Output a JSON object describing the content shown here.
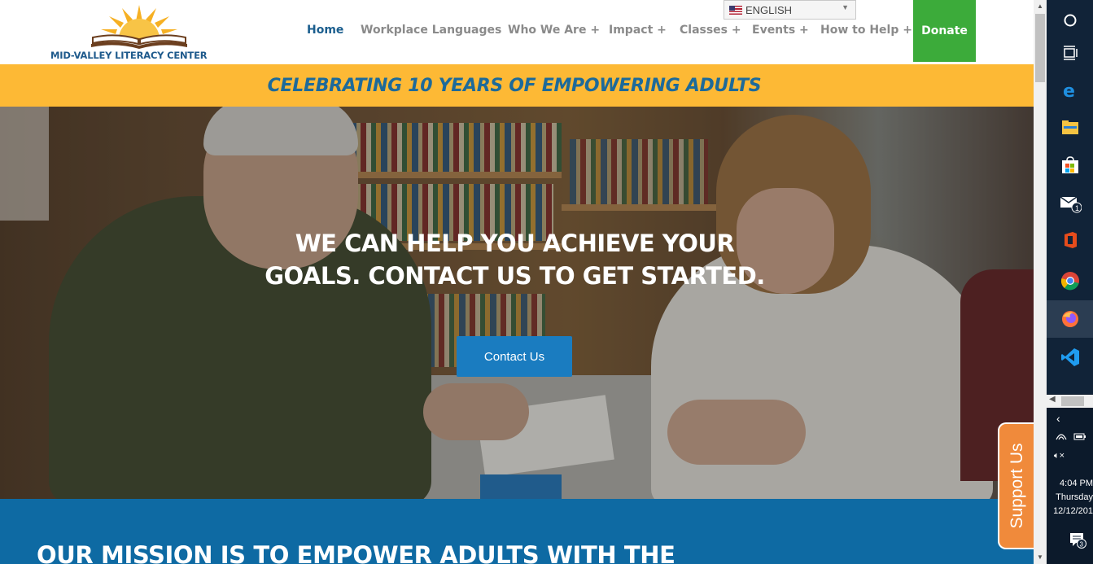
{
  "site": {
    "logo_text": "MID-VALLEY LITERACY CENTER",
    "language": {
      "label": "ENGLISH"
    },
    "nav": [
      {
        "label": "Home",
        "active": true
      },
      {
        "label": "Workplace Languages"
      },
      {
        "label": "Who We Are +"
      },
      {
        "label": "Impact +"
      },
      {
        "label": "Classes +"
      },
      {
        "label": "Events +"
      },
      {
        "label": "How to Help +"
      }
    ],
    "donate_label": "Donate",
    "banner_text": "CELEBRATING 10 YEARS OF EMPOWERING ADULTS",
    "hero": {
      "title_line1": "WE CAN HELP YOU ACHIEVE YOUR",
      "title_line2": "GOALS. CONTACT US TO GET STARTED.",
      "button_label": "Contact Us"
    },
    "mission_text": "OUR MISSION IS TO EMPOWER ADULTS WITH THE",
    "support_tab_label": "Support Us"
  },
  "colors": {
    "brand_blue": "#1b5e8e",
    "banner_yellow": "#fdb935",
    "donate_green": "#3cab3a",
    "cta_blue": "#1a7cc0",
    "mission_blue": "#0e6aa3",
    "support_orange": "#f08a3b",
    "taskbar": "#112338"
  },
  "taskbar": {
    "icons": [
      "cortana-circle-icon",
      "task-view-icon",
      "edge-icon",
      "file-explorer-icon",
      "store-icon",
      "mail-icon",
      "office-icon",
      "chrome-icon",
      "firefox-icon",
      "vscode-icon"
    ],
    "mail_badge": "1",
    "notification_badge": "3",
    "clock": {
      "time": "4:04 PM",
      "day": "Thursday",
      "date": "12/12/201"
    }
  }
}
